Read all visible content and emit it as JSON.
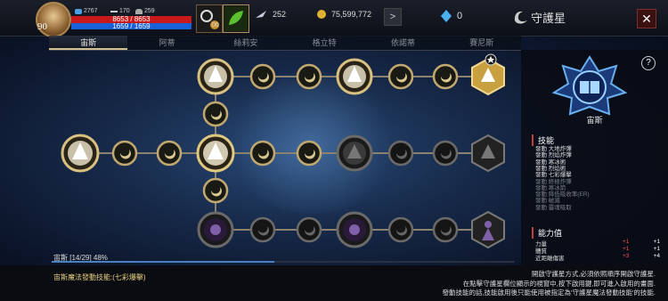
{
  "player": {
    "level": "90",
    "stat1": "2767",
    "stat2": "170",
    "stat3": "259",
    "hp": "8653 / 8653",
    "mp": "1659 / 1659",
    "slot2_count": "00"
  },
  "currency": {
    "feather": "252",
    "gold": "75,599,772",
    "crystal": "0",
    "arrow": ">"
  },
  "window": {
    "title": "守護星",
    "close": "✕",
    "help": "?"
  },
  "tabs": [
    "宙斯",
    "阿蒂",
    "絲莉安",
    "格立特",
    "依諾蒂",
    "賽尼斯"
  ],
  "emblem": {
    "name": "宙斯"
  },
  "skills": {
    "header": "技能",
    "items": [
      {
        "label": "發動 大地炸彈",
        "dim": false
      },
      {
        "label": "發動 烈焰炸彈",
        "dim": false
      },
      {
        "label": "發動 寒冰術",
        "dim": false
      },
      {
        "label": "發動 烈焰術",
        "dim": false
      },
      {
        "label": "發動 七彩爆擊",
        "dim": false
      },
      {
        "label": "發動 終極炸彈",
        "dim": true
      },
      {
        "label": "發動 寒冰箭",
        "dim": true
      },
      {
        "label": "發動 降低吸收率(ER)",
        "dim": true
      },
      {
        "label": "發動 破滅",
        "dim": true
      },
      {
        "label": "發動 靈魂吸取",
        "dim": true
      }
    ]
  },
  "abilities": {
    "header": "能力值",
    "rows": [
      {
        "label": "力量",
        "delta": "+1",
        "value": "+1"
      },
      {
        "label": "體質",
        "delta": "+1",
        "value": "+1"
      },
      {
        "label": "近距離傷害",
        "delta": "+3",
        "value": "+4"
      }
    ]
  },
  "progress": {
    "label": "宙斯 [14/29] 48%",
    "fraction": 0.48
  },
  "magic_skill": "宙斯魔法發動技能:(七彩爆擊)",
  "hint_lines": [
    "開啟守護星方式,必須依照順序開啟守護星.",
    "在點擊守護星欄位顯示的視窗中,按下啟用鍵,即可進入啟用的畫面.",
    "發動技能的話,技能啟用後只能使用被指定為'守護星魔法發動技能'的技能."
  ]
}
